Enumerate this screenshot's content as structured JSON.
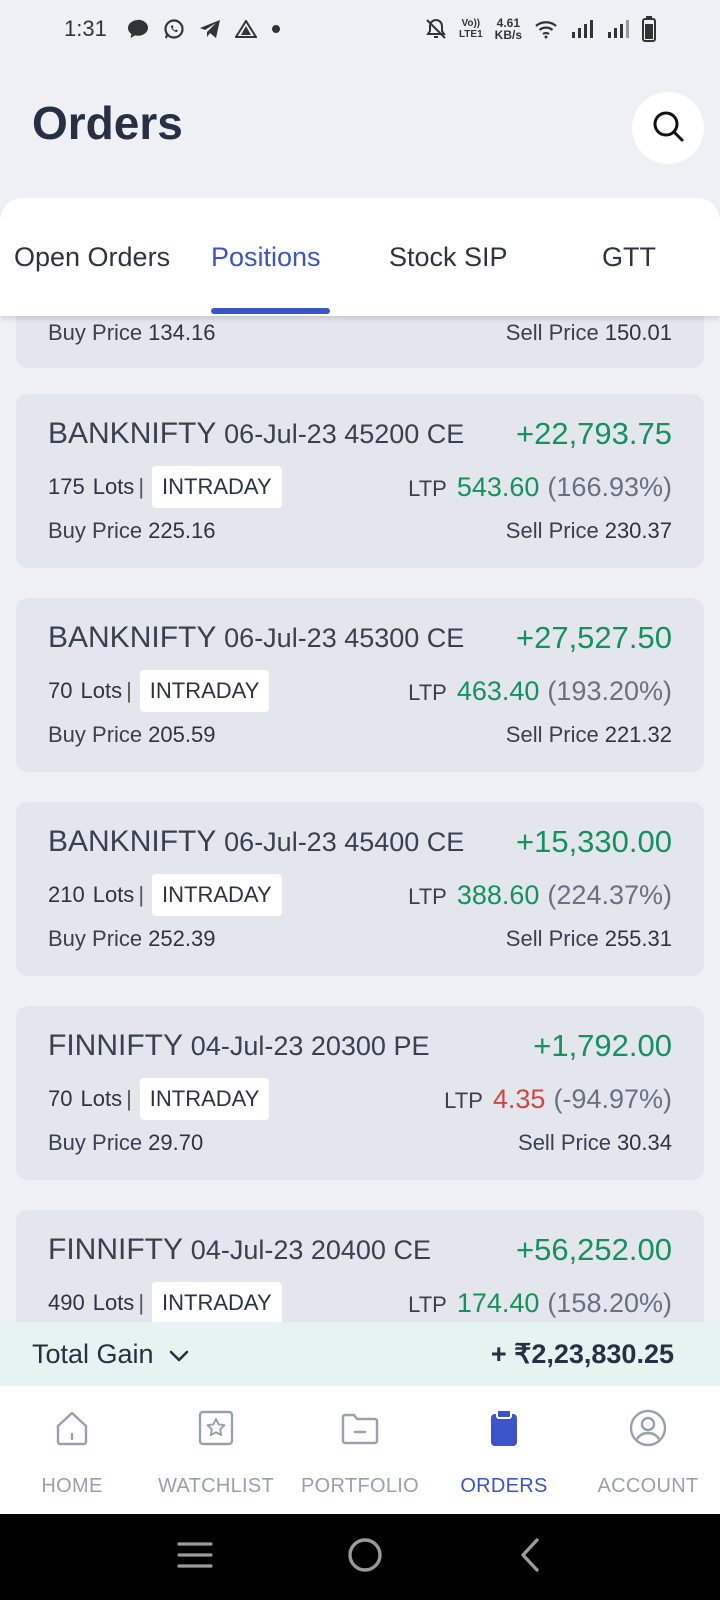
{
  "status_bar": {
    "time": "1:31",
    "net_speed_value": "4.61",
    "net_speed_unit": "KB/s",
    "volte_top": "Vo))",
    "volte_bottom": "LTE1"
  },
  "header": {
    "title": "Orders"
  },
  "tabs": [
    {
      "label": "Open Orders",
      "active": false
    },
    {
      "label": "Positions",
      "active": true
    },
    {
      "label": "Stock SIP",
      "active": false
    },
    {
      "label": "GTT",
      "active": false
    }
  ],
  "labels": {
    "lots": "Lots",
    "ltp": "LTP",
    "buy_price": "Buy Price",
    "sell_price": "Sell Price"
  },
  "partial_card": {
    "buy_price": "134.16",
    "sell_price": "150.01"
  },
  "positions": [
    {
      "symbol": "BANKNIFTY",
      "detail": "06-Jul-23 45200 CE",
      "pnl": "+22,793.75",
      "lots": "175",
      "type": "INTRADAY",
      "ltp": "543.60",
      "ltp_change": "(166.93%)",
      "buy_price": "225.16",
      "sell_price": "230.37"
    },
    {
      "symbol": "BANKNIFTY",
      "detail": "06-Jul-23 45300 CE",
      "pnl": "+27,527.50",
      "lots": "70",
      "type": "INTRADAY",
      "ltp": "463.40",
      "ltp_change": "(193.20%)",
      "buy_price": "205.59",
      "sell_price": "221.32"
    },
    {
      "symbol": "BANKNIFTY",
      "detail": "06-Jul-23 45400 CE",
      "pnl": "+15,330.00",
      "lots": "210",
      "type": "INTRADAY",
      "ltp": "388.60",
      "ltp_change": "(224.37%)",
      "buy_price": "252.39",
      "sell_price": "255.31"
    },
    {
      "symbol": "FINNIFTY",
      "detail": "04-Jul-23 20300 PE",
      "pnl": "+1,792.00",
      "lots": "70",
      "type": "INTRADAY",
      "ltp": "4.35",
      "ltp_change": "(-94.97%)",
      "buy_price": "29.70",
      "sell_price": "30.34"
    },
    {
      "symbol": "FINNIFTY",
      "detail": "04-Jul-23 20400 CE",
      "pnl": "+56,252.00",
      "lots": "490",
      "type": "INTRADAY",
      "ltp": "174.40",
      "ltp_change": "(158.20%)"
    }
  ],
  "total_gain": {
    "label": "Total Gain",
    "value": "+ ₹2,23,830.25"
  },
  "bottom_nav": [
    {
      "label": "HOME",
      "icon": "home-icon",
      "active": false
    },
    {
      "label": "WATCHLIST",
      "icon": "watchlist-icon",
      "active": false
    },
    {
      "label": "PORTFOLIO",
      "icon": "portfolio-icon",
      "active": false
    },
    {
      "label": "ORDERS",
      "icon": "orders-icon",
      "active": true
    },
    {
      "label": "ACCOUNT",
      "icon": "account-icon",
      "active": false
    }
  ],
  "colors": {
    "accent": "#3b54c9",
    "gain": "#15915d",
    "loss": "#d24545",
    "background": "#eef0f6",
    "card": "#e4e6ee",
    "total_gain_bg": "#e5f4f1"
  }
}
